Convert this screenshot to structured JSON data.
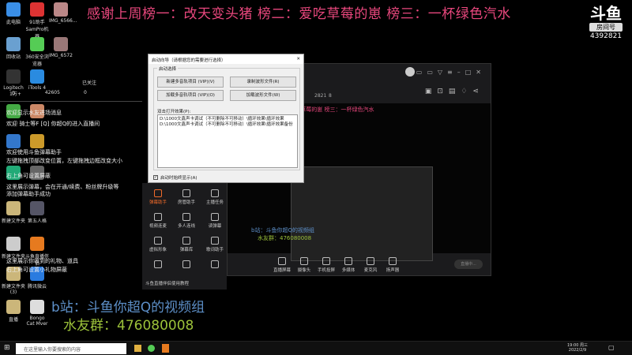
{
  "banner": "感谢上周榜一：改天变头猪 榜二：爱吃草莓的崽 榜三：一杯绿色汽水",
  "logo": {
    "mark": "斗鱼",
    "tag": "房间号",
    "room": "4392821"
  },
  "desktop_icons": [
    {
      "label": "此电脑",
      "color": "#3a8ee6"
    },
    {
      "label": "91助手 SamPro机器",
      "color": "#d33"
    },
    {
      "label": "IMG_6566...",
      "color": "#b88"
    },
    {
      "label": "回收站",
      "color": "#6aa0d0"
    },
    {
      "label": "360安全浏览器",
      "color": "#5c5"
    },
    {
      "label": "IMG_6572",
      "color": "#977"
    },
    {
      "label": "Logitech G",
      "color": "#333"
    },
    {
      "label": "iTools 4",
      "color": "#2a8be0"
    },
    {
      "label": "",
      "color": "#4a4"
    },
    {
      "label": "",
      "color": "#c86"
    },
    {
      "label": "",
      "color": "#37c"
    },
    {
      "label": "",
      "color": "#cc9a2a"
    },
    {
      "label": "",
      "color": "#2a7"
    },
    {
      "label": "",
      "color": "#666"
    },
    {
      "label": "新建文件夹",
      "color": "#cbb67a"
    },
    {
      "label": "第五人格",
      "color": "#556"
    },
    {
      "label": "新建文件夹",
      "color": "#ccc"
    },
    {
      "label": "斗鱼直播伴侣",
      "color": "#e67a1f"
    },
    {
      "label": "新建文件夹 (3)",
      "color": "#cbb67a"
    },
    {
      "label": "腾讯微云",
      "color": "#2a7be0"
    },
    {
      "label": "直播",
      "color": "#cbb67a"
    },
    {
      "label": "Bongo Cat Mver",
      "color": "#ddd"
    }
  ],
  "stats": {
    "likes": "1万+",
    "fans": "42605",
    "gifts": "0",
    "follow": "已关注"
  },
  "chat": [
    "欢迎显示水友进场消息",
    "欢迎 骑士等F [Q] 你超Q的进入直播间",
    "欢迎使用斗鱼弹幕助手",
    "左键拖拽顶部改变位置，左键拖拽边框改变大小",
    "右上角可设置屏蔽",
    "这里展示弹幕，会在开通/续费、粉丝牌升级等",
    "添加弹幕助手成功",
    "这里展示你收到的礼物、道具",
    "右上角可设置小礼物屏蔽"
  ],
  "dialog": {
    "title": "启动向导（请根据您的需要进行选择）",
    "close": "✕",
    "group": "启动选择",
    "buttons": [
      "新建多音轨项目 (VIP)(V)",
      "录制波形文件(R)",
      "加载多音轨项目 (VIP)(O)",
      "加载波形文件(W)"
    ],
    "recent_label": "双击打开效果(P):",
    "recent": [
      "D:\\1000文鑫声卡调试（不可删除不可移动）\\循环效果\\循环效果",
      "D:\\1000文鑫声卡调试（不可删除不可移动）\\循环效果\\循环效果备份"
    ],
    "checkbox": "启动时始终显示(A)",
    "checked": true
  },
  "app": {
    "room_id": "2821",
    "viewers": "8",
    "banner": "改天变头猪 榜二：爱吃草莓的崽 榜三：一杯绿色汽水",
    "tools": [
      "弹幕助手",
      "房管助手",
      "主播任务",
      "视频连麦",
      "多人连线",
      "读弹幕",
      "虚拟形象",
      "弹幕库",
      "歌词助手",
      "",
      "",
      ""
    ],
    "notice": "斗鱼直播伴侣使用教程",
    "bottom": [
      "直播屏幕",
      "摄像头",
      "手机投屏",
      "多媒体",
      "麦克风",
      "扬声器"
    ],
    "live_button": "直播中...",
    "inner_b": "b站：斗鱼你超Q的视频组",
    "inner_q": "水友群：476080008"
  },
  "overlay": {
    "bilibili": "b站：斗鱼你超Q的视频组",
    "qq_group": "水友群：476080008"
  },
  "taskbar": {
    "search_placeholder": "在这里输入你要搜索的内容",
    "time": "19:00 周三",
    "date": "2022/2/9"
  }
}
